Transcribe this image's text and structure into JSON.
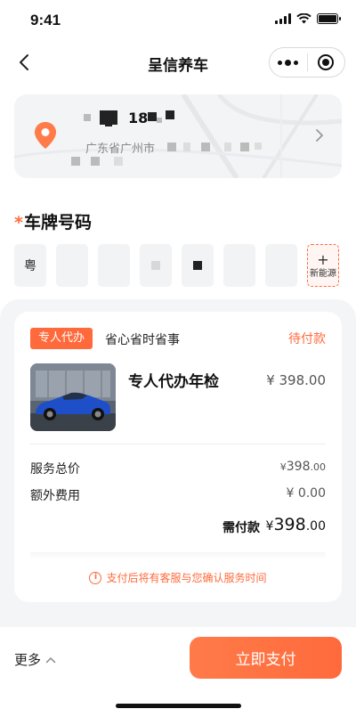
{
  "status_bar": {
    "time": "9:41"
  },
  "nav": {
    "title": "呈信养车"
  },
  "address": {
    "name_visible": "18",
    "detail_visible": "广东省广州市"
  },
  "plate": {
    "label": "车牌号码",
    "required_mark": "*",
    "province": "粤",
    "new_energy_label": "新能源",
    "new_energy_plus": "+"
  },
  "order": {
    "tag": "专人代办",
    "tag_desc": "省心省时省事",
    "status": "待付款",
    "service_name": "专人代办年检",
    "service_price": "¥ 398.00",
    "service_total_label": "服务总价",
    "service_total_currency": "¥",
    "service_total_int": "398",
    "service_total_dec": ".00",
    "extra_fee_label": "额外费用",
    "extra_fee_value": "¥ 0.00",
    "pay_due_label": "需付款",
    "pay_due_currency": "¥",
    "pay_due_int": "398",
    "pay_due_dec": ".00",
    "notice": "支付后将有客服与您确认服务时间",
    "notice_icon": "i"
  },
  "bottom": {
    "more_label": "更多",
    "pay_label": "立即支付"
  },
  "colors": {
    "accent": "#ff6a3c",
    "panel_bg": "#f4f5f7"
  },
  "icons": {
    "back": "chevron-left-icon",
    "more": "more-dots-icon",
    "close": "target-close-icon",
    "location": "location-pin-icon",
    "address_arrow": "chevron-right-icon",
    "more_toggle": "chevron-up-icon",
    "info": "info-icon"
  }
}
